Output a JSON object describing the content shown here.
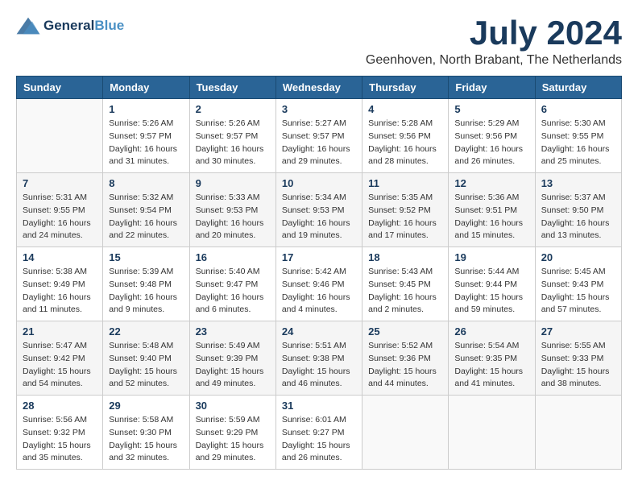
{
  "header": {
    "logo_line1": "General",
    "logo_line2": "Blue",
    "month_title": "July 2024",
    "location": "Geenhoven, North Brabant, The Netherlands"
  },
  "weekdays": [
    "Sunday",
    "Monday",
    "Tuesday",
    "Wednesday",
    "Thursday",
    "Friday",
    "Saturday"
  ],
  "weeks": [
    [
      {
        "day": "",
        "sunrise": "",
        "sunset": "",
        "daylight": ""
      },
      {
        "day": "1",
        "sunrise": "Sunrise: 5:26 AM",
        "sunset": "Sunset: 9:57 PM",
        "daylight": "Daylight: 16 hours and 31 minutes."
      },
      {
        "day": "2",
        "sunrise": "Sunrise: 5:26 AM",
        "sunset": "Sunset: 9:57 PM",
        "daylight": "Daylight: 16 hours and 30 minutes."
      },
      {
        "day": "3",
        "sunrise": "Sunrise: 5:27 AM",
        "sunset": "Sunset: 9:57 PM",
        "daylight": "Daylight: 16 hours and 29 minutes."
      },
      {
        "day": "4",
        "sunrise": "Sunrise: 5:28 AM",
        "sunset": "Sunset: 9:56 PM",
        "daylight": "Daylight: 16 hours and 28 minutes."
      },
      {
        "day": "5",
        "sunrise": "Sunrise: 5:29 AM",
        "sunset": "Sunset: 9:56 PM",
        "daylight": "Daylight: 16 hours and 26 minutes."
      },
      {
        "day": "6",
        "sunrise": "Sunrise: 5:30 AM",
        "sunset": "Sunset: 9:55 PM",
        "daylight": "Daylight: 16 hours and 25 minutes."
      }
    ],
    [
      {
        "day": "7",
        "sunrise": "Sunrise: 5:31 AM",
        "sunset": "Sunset: 9:55 PM",
        "daylight": "Daylight: 16 hours and 24 minutes."
      },
      {
        "day": "8",
        "sunrise": "Sunrise: 5:32 AM",
        "sunset": "Sunset: 9:54 PM",
        "daylight": "Daylight: 16 hours and 22 minutes."
      },
      {
        "day": "9",
        "sunrise": "Sunrise: 5:33 AM",
        "sunset": "Sunset: 9:53 PM",
        "daylight": "Daylight: 16 hours and 20 minutes."
      },
      {
        "day": "10",
        "sunrise": "Sunrise: 5:34 AM",
        "sunset": "Sunset: 9:53 PM",
        "daylight": "Daylight: 16 hours and 19 minutes."
      },
      {
        "day": "11",
        "sunrise": "Sunrise: 5:35 AM",
        "sunset": "Sunset: 9:52 PM",
        "daylight": "Daylight: 16 hours and 17 minutes."
      },
      {
        "day": "12",
        "sunrise": "Sunrise: 5:36 AM",
        "sunset": "Sunset: 9:51 PM",
        "daylight": "Daylight: 16 hours and 15 minutes."
      },
      {
        "day": "13",
        "sunrise": "Sunrise: 5:37 AM",
        "sunset": "Sunset: 9:50 PM",
        "daylight": "Daylight: 16 hours and 13 minutes."
      }
    ],
    [
      {
        "day": "14",
        "sunrise": "Sunrise: 5:38 AM",
        "sunset": "Sunset: 9:49 PM",
        "daylight": "Daylight: 16 hours and 11 minutes."
      },
      {
        "day": "15",
        "sunrise": "Sunrise: 5:39 AM",
        "sunset": "Sunset: 9:48 PM",
        "daylight": "Daylight: 16 hours and 9 minutes."
      },
      {
        "day": "16",
        "sunrise": "Sunrise: 5:40 AM",
        "sunset": "Sunset: 9:47 PM",
        "daylight": "Daylight: 16 hours and 6 minutes."
      },
      {
        "day": "17",
        "sunrise": "Sunrise: 5:42 AM",
        "sunset": "Sunset: 9:46 PM",
        "daylight": "Daylight: 16 hours and 4 minutes."
      },
      {
        "day": "18",
        "sunrise": "Sunrise: 5:43 AM",
        "sunset": "Sunset: 9:45 PM",
        "daylight": "Daylight: 16 hours and 2 minutes."
      },
      {
        "day": "19",
        "sunrise": "Sunrise: 5:44 AM",
        "sunset": "Sunset: 9:44 PM",
        "daylight": "Daylight: 15 hours and 59 minutes."
      },
      {
        "day": "20",
        "sunrise": "Sunrise: 5:45 AM",
        "sunset": "Sunset: 9:43 PM",
        "daylight": "Daylight: 15 hours and 57 minutes."
      }
    ],
    [
      {
        "day": "21",
        "sunrise": "Sunrise: 5:47 AM",
        "sunset": "Sunset: 9:42 PM",
        "daylight": "Daylight: 15 hours and 54 minutes."
      },
      {
        "day": "22",
        "sunrise": "Sunrise: 5:48 AM",
        "sunset": "Sunset: 9:40 PM",
        "daylight": "Daylight: 15 hours and 52 minutes."
      },
      {
        "day": "23",
        "sunrise": "Sunrise: 5:49 AM",
        "sunset": "Sunset: 9:39 PM",
        "daylight": "Daylight: 15 hours and 49 minutes."
      },
      {
        "day": "24",
        "sunrise": "Sunrise: 5:51 AM",
        "sunset": "Sunset: 9:38 PM",
        "daylight": "Daylight: 15 hours and 46 minutes."
      },
      {
        "day": "25",
        "sunrise": "Sunrise: 5:52 AM",
        "sunset": "Sunset: 9:36 PM",
        "daylight": "Daylight: 15 hours and 44 minutes."
      },
      {
        "day": "26",
        "sunrise": "Sunrise: 5:54 AM",
        "sunset": "Sunset: 9:35 PM",
        "daylight": "Daylight: 15 hours and 41 minutes."
      },
      {
        "day": "27",
        "sunrise": "Sunrise: 5:55 AM",
        "sunset": "Sunset: 9:33 PM",
        "daylight": "Daylight: 15 hours and 38 minutes."
      }
    ],
    [
      {
        "day": "28",
        "sunrise": "Sunrise: 5:56 AM",
        "sunset": "Sunset: 9:32 PM",
        "daylight": "Daylight: 15 hours and 35 minutes."
      },
      {
        "day": "29",
        "sunrise": "Sunrise: 5:58 AM",
        "sunset": "Sunset: 9:30 PM",
        "daylight": "Daylight: 15 hours and 32 minutes."
      },
      {
        "day": "30",
        "sunrise": "Sunrise: 5:59 AM",
        "sunset": "Sunset: 9:29 PM",
        "daylight": "Daylight: 15 hours and 29 minutes."
      },
      {
        "day": "31",
        "sunrise": "Sunrise: 6:01 AM",
        "sunset": "Sunset: 9:27 PM",
        "daylight": "Daylight: 15 hours and 26 minutes."
      },
      {
        "day": "",
        "sunrise": "",
        "sunset": "",
        "daylight": ""
      },
      {
        "day": "",
        "sunrise": "",
        "sunset": "",
        "daylight": ""
      },
      {
        "day": "",
        "sunrise": "",
        "sunset": "",
        "daylight": ""
      }
    ]
  ]
}
